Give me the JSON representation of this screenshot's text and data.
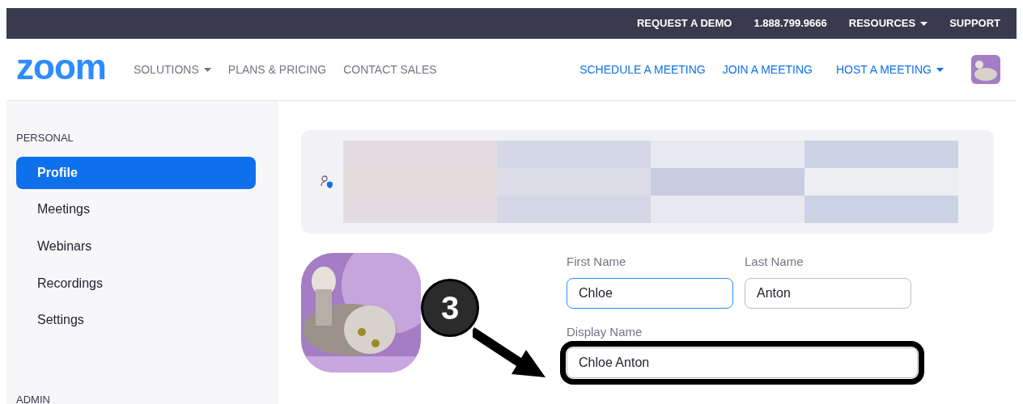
{
  "top_bar": {
    "links": [
      {
        "label": "REQUEST A DEMO",
        "dropdown": false
      },
      {
        "label": "1.888.799.9666",
        "dropdown": false
      },
      {
        "label": "RESOURCES",
        "dropdown": true
      },
      {
        "label": "SUPPORT",
        "dropdown": false
      }
    ]
  },
  "nav": {
    "logo": "zoom",
    "left_links": [
      {
        "label": "SOLUTIONS",
        "dropdown": true
      },
      {
        "label": "PLANS & PRICING",
        "dropdown": false
      },
      {
        "label": "CONTACT SALES",
        "dropdown": false
      }
    ],
    "right_links": [
      {
        "label": "SCHEDULE A MEETING",
        "dropdown": false
      },
      {
        "label": "JOIN A MEETING",
        "dropdown": false
      },
      {
        "label": "HOST A MEETING",
        "dropdown": true
      }
    ]
  },
  "sidebar": {
    "sections": [
      {
        "heading": "PERSONAL",
        "items": [
          {
            "label": "Profile",
            "selected": true
          },
          {
            "label": "Meetings",
            "selected": false
          },
          {
            "label": "Webinars",
            "selected": false
          },
          {
            "label": "Recordings",
            "selected": false
          },
          {
            "label": "Settings",
            "selected": false
          }
        ]
      },
      {
        "heading": "ADMIN"
      }
    ]
  },
  "profile": {
    "fields": [
      {
        "label": "First Name",
        "value": "Chloe",
        "focused": true,
        "highlighted": false
      },
      {
        "label": "Last Name",
        "value": "Anton",
        "focused": false,
        "highlighted": false
      },
      {
        "label": "Display Name",
        "value": "Chloe Anton",
        "focused": false,
        "highlighted": true
      }
    ]
  },
  "annotation": {
    "step": "3"
  }
}
